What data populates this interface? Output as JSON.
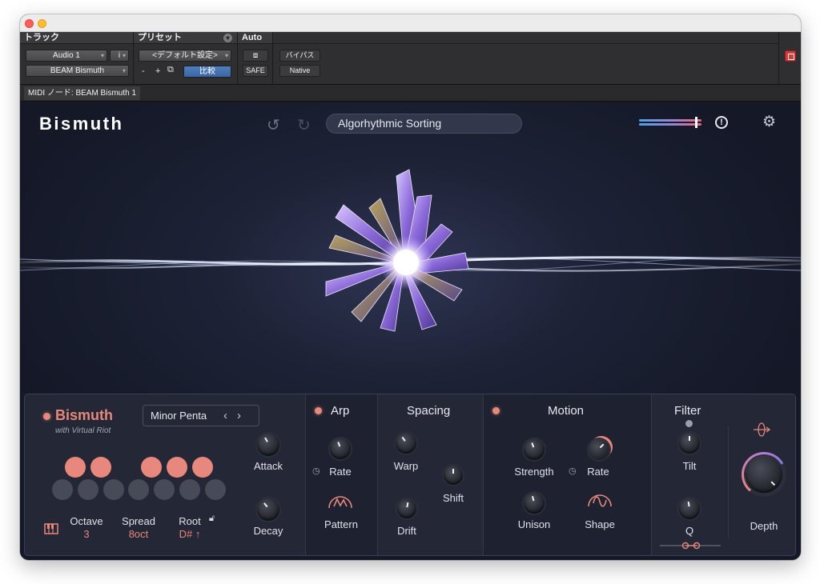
{
  "host": {
    "track_header": "トラック",
    "preset_header": "プリセット",
    "auto_header": "Auto",
    "track_name": "Audio 1",
    "track_info": "i",
    "plugin_name": "BEAM Bismuth",
    "preset_value": "<デフォルト設定>",
    "minus": "-",
    "plus": "+",
    "compare": "比較",
    "safe": "SAFE",
    "bypass": "バイパス",
    "native": "Native",
    "midi_node": "MIDI ノード: BEAM Bismuth 1"
  },
  "plugin": {
    "logo": "Bismuth",
    "preset_name": "Algorhythmic Sorting",
    "warning_symbol": "!",
    "output_meter_level": 0.9
  },
  "panel": {
    "brand": "Bismuth",
    "brand_sub": "with Virtual Riot",
    "scale": "Minor Penta",
    "scale_prev": "‹",
    "scale_next": "›",
    "pads_top": [
      true,
      true,
      false,
      true,
      true,
      true
    ],
    "pads_bottom": [
      false,
      false,
      false,
      false,
      false,
      false,
      false
    ],
    "octave_label": "Octave",
    "octave_value": "3",
    "spread_label": "Spread",
    "spread_value": "8oct",
    "root_label": "Root",
    "root_value": "D# ↑",
    "attack": "Attack",
    "decay": "Decay",
    "arp": "Arp",
    "arp_rate": "Rate",
    "arp_pattern": "Pattern",
    "spacing": "Spacing",
    "warp": "Warp",
    "shift": "Shift",
    "drift": "Drift",
    "motion": "Motion",
    "strength": "Strength",
    "motion_rate": "Rate",
    "unison": "Unison",
    "shape": "Shape",
    "filter": "Filter",
    "tilt": "Tilt",
    "q": "Q",
    "depth": "Depth"
  },
  "colors": {
    "accent": "#e8877c",
    "panel_bg": "#242735",
    "plugin_bg": "#1d2236",
    "meter_start": "#4ba3e2",
    "meter_end": "#e8677b"
  },
  "icons": [
    "undo-icon",
    "redo-icon",
    "warning-icon",
    "gear-icon",
    "piano-icon",
    "lock-icon",
    "clock-icon",
    "pattern-icon",
    "sine-wave-icon",
    "depth-orbit-icon"
  ]
}
